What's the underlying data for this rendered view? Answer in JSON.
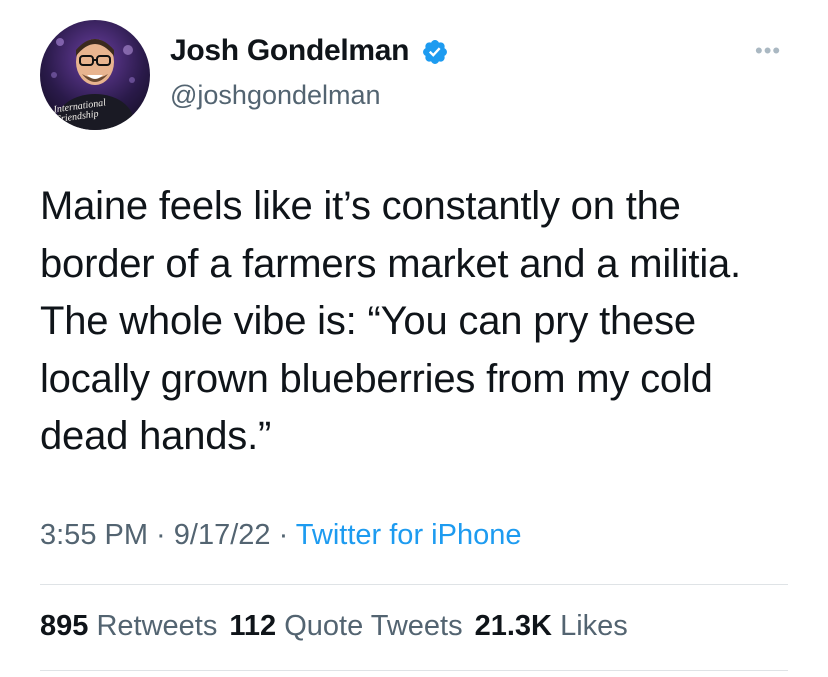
{
  "author": {
    "name": "Josh Gondelman",
    "handle": "@joshgondelman",
    "avatar_caption": "International Friendship",
    "verified_color": "#1d9bf0"
  },
  "tweet": {
    "text": "Maine feels like it’s constantly on the border of a farmers market and a militia. The whole vibe is: “You can pry these locally grown blueberries from my cold dead hands.”"
  },
  "meta": {
    "time": "3:55 PM",
    "separator": " · ",
    "date": "9/17/22",
    "source": "Twitter for iPhone"
  },
  "stats": {
    "retweets_count": "895",
    "retweets_label": "Retweets",
    "quotes_count": "112",
    "quotes_label": "Quote Tweets",
    "likes_count": "21.3K",
    "likes_label": "Likes"
  },
  "icons": {
    "more": "more-options-icon",
    "verified": "verified-badge-icon"
  }
}
